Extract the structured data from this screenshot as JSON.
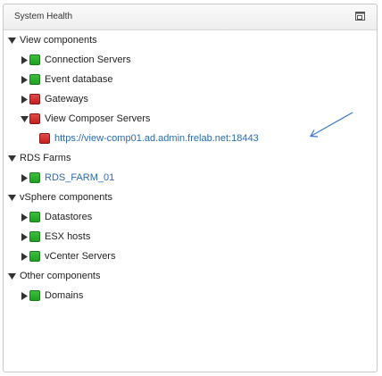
{
  "panel": {
    "title": "System Health",
    "restore_icon": "restore-window-icon"
  },
  "tree": {
    "view_components": {
      "label": "View components",
      "children": {
        "connection_servers": "Connection Servers",
        "event_database": "Event database",
        "gateways": "Gateways",
        "view_composer_servers": {
          "label": "View Composer Servers",
          "child": "https://view-comp01.ad.admin.frelab.net:18443"
        }
      }
    },
    "rds_farms": {
      "label": "RDS Farms",
      "children": {
        "rds_farm_01": "RDS_FARM_01"
      }
    },
    "vsphere_components": {
      "label": "vSphere components",
      "children": {
        "datastores": "Datastores",
        "esx_hosts": "ESX hosts",
        "vcenter_servers": "vCenter Servers"
      }
    },
    "other_components": {
      "label": "Other components",
      "children": {
        "domains": "Domains"
      }
    }
  },
  "status_colors": {
    "healthy": "#2bb02b",
    "error": "#d02a2a",
    "link": "#2a6bb0",
    "annotation_arrow": "#3a78c8"
  }
}
